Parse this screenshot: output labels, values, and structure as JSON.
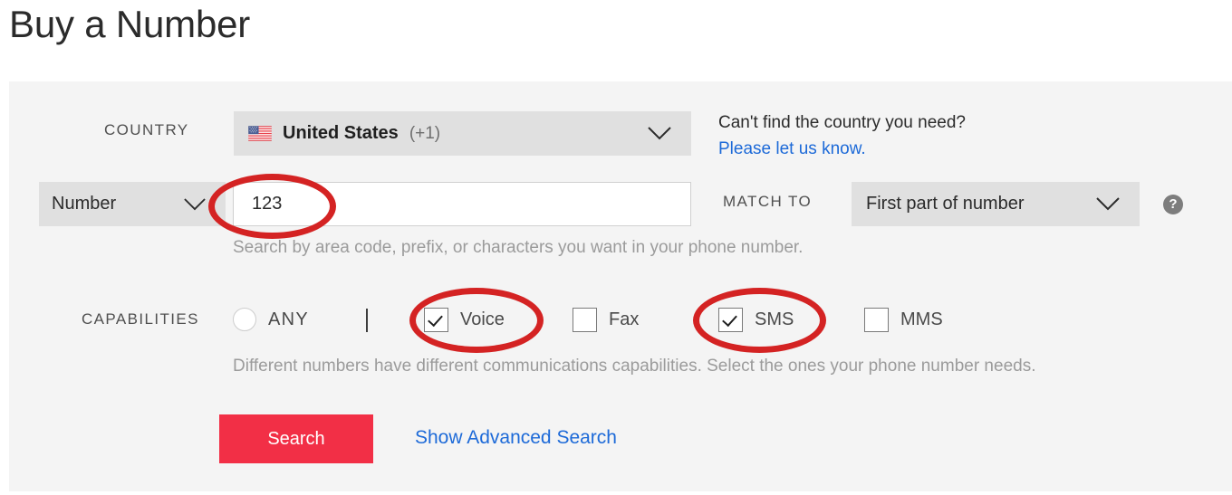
{
  "page": {
    "title": "Buy a Number"
  },
  "country": {
    "label": "COUNTRY",
    "selected": "United States",
    "dial_code": "(+1)",
    "flag_icon": "us-flag-icon",
    "chevron_icon": "chevron-down-icon",
    "help_question": "Can't find the country you need?",
    "help_link": "Please let us know."
  },
  "number": {
    "type_selected": "Number",
    "type_chevron_icon": "chevron-down-icon",
    "value": "123",
    "placeholder": "",
    "hint": "Search by area code, prefix, or characters you want in your phone number.",
    "match_label": "MATCH TO",
    "match_selected": "First part of number",
    "match_chevron_icon": "chevron-down-icon",
    "help_icon": "question-mark-icon",
    "help_icon_glyph": "?"
  },
  "capabilities": {
    "label": "CAPABILITIES",
    "any": {
      "label": "ANY",
      "selected": false
    },
    "options": [
      {
        "label": "Voice",
        "checked": true
      },
      {
        "label": "Fax",
        "checked": false
      },
      {
        "label": "SMS",
        "checked": true
      },
      {
        "label": "MMS",
        "checked": false
      }
    ],
    "hint": "Different numbers have different communications capabilities. Select the ones your phone number needs."
  },
  "actions": {
    "search_label": "Search",
    "advanced_label": "Show Advanced Search"
  },
  "annotations": [
    {
      "name": "number-field-highlight",
      "shape": "ellipse",
      "color": "#d42323"
    },
    {
      "name": "voice-checkbox-highlight",
      "shape": "ellipse",
      "color": "#d42323"
    },
    {
      "name": "sms-checkbox-highlight",
      "shape": "ellipse",
      "color": "#d42323"
    }
  ],
  "colors": {
    "brand_red": "#f22f46",
    "link_blue": "#1d6ad8",
    "panel_bg": "#f4f4f4",
    "control_bg": "#e0e0e0",
    "annotation_red": "#d42323"
  }
}
